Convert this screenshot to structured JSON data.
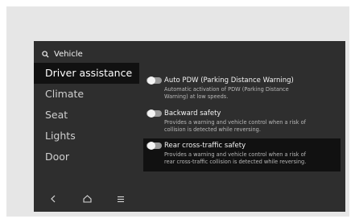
{
  "header": {
    "title": "Vehicle",
    "icon": "search-icon"
  },
  "sidebar": {
    "items": [
      {
        "label": "Driver assistance",
        "active": true
      },
      {
        "label": "Climate",
        "active": false
      },
      {
        "label": "Seat",
        "active": false
      },
      {
        "label": "Lights",
        "active": false
      },
      {
        "label": "Door",
        "active": false
      }
    ]
  },
  "bottom_nav": {
    "icons": [
      "back-icon",
      "home-icon",
      "menu-icon"
    ]
  },
  "settings": [
    {
      "title": "Auto PDW (Parking Distance Warning)",
      "description": [
        "Automatic activation of PDW (Parking Distance",
        "Warning) at low speeds."
      ],
      "enabled": false,
      "highlighted": false
    },
    {
      "title": "Backward safety",
      "description": [
        "Provides a warning and vehicle control when a risk of",
        "collision is detected while reversing."
      ],
      "enabled": false,
      "highlighted": false
    },
    {
      "title": "Rear cross-traffic safety",
      "description": [
        "Provides a warning and vehicle control when a risk of",
        "rear cross-traffic collision is detected while reversing."
      ],
      "enabled": false,
      "highlighted": true
    }
  ],
  "colors": {
    "screen_bg": "#2e2e2e",
    "active_bg": "#111111",
    "outer_bg": "#e6e6e6"
  }
}
